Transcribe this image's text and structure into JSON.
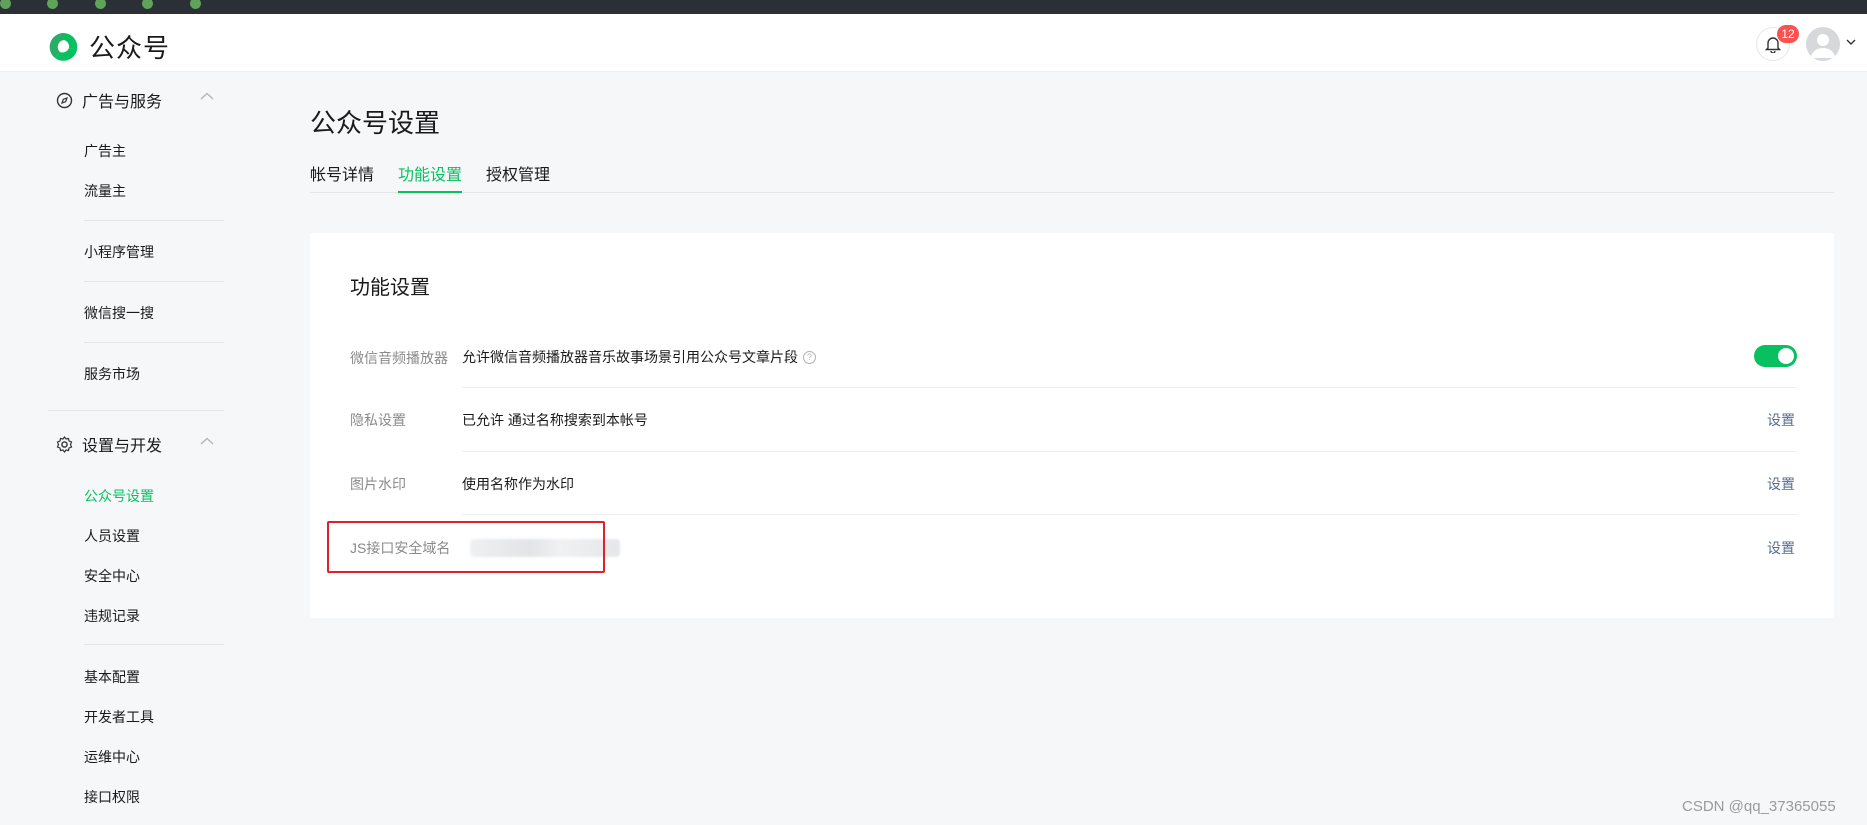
{
  "header": {
    "logo_text": "公众号",
    "notification_count": "12",
    "bell_icon": "bell-icon",
    "avatar_icon": "user-avatar-icon"
  },
  "sidebar": {
    "group1": {
      "label": "广告与服务",
      "icon": "compass-icon"
    },
    "group1_items": [
      "广告主",
      "流量主",
      "小程序管理",
      "微信搜一搜",
      "服务市场"
    ],
    "group2": {
      "label": "设置与开发",
      "icon": "gear-icon"
    },
    "group2_items": [
      "公众号设置",
      "人员设置",
      "安全中心",
      "违规记录",
      "基本配置",
      "开发者工具",
      "运维中心",
      "接口权限"
    ],
    "active_item": "公众号设置"
  },
  "main": {
    "title": "公众号设置",
    "tabs": [
      "帐号详情",
      "功能设置",
      "授权管理"
    ],
    "active_tab": "功能设置",
    "card": {
      "title": "功能设置",
      "rows": [
        {
          "label": "微信音频播放器",
          "desc": "允许微信音频播放器音乐故事场景引用公众号文章片段",
          "toggle_on": true
        },
        {
          "label": "隐私设置",
          "desc": "已允许 通过名称搜索到本帐号",
          "action": "设置"
        },
        {
          "label": "图片水印",
          "desc": "使用名称作为水印",
          "action": "设置"
        },
        {
          "label": "JS接口安全域名",
          "desc": "",
          "action": "设置"
        }
      ]
    }
  },
  "watermark": "CSDN @qq_37365055",
  "colors": {
    "accent": "#07c160",
    "link": "#576b95",
    "highlight": "#e0212b",
    "badge": "#fa5151"
  }
}
